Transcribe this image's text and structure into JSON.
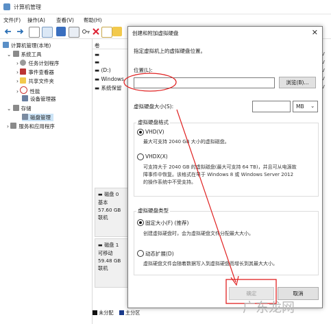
{
  "window": {
    "title": "计算机管理"
  },
  "menu": [
    "文件(F)",
    "操作(A)",
    "查看(V)",
    "帮助(H)"
  ],
  "tree": {
    "root": "计算机管理(本地)",
    "system_tools": "系统工具",
    "task_scheduler": "任务计划程序",
    "event_viewer": "事件查看器",
    "shared_folders": "共享文件夹",
    "performance": "性能",
    "device_manager": "设备管理器",
    "storage": "存储",
    "disk_management": "磁盘管理",
    "services": "服务和应用程序"
  },
  "volume_list": {
    "header": "卷",
    "rows": [
      "",
      "",
      "(D:)",
      "Windows",
      "系统保留"
    ]
  },
  "disks": [
    {
      "name": "磁盘 0",
      "type": "基本",
      "size": "57.60 GB",
      "status": "联机"
    },
    {
      "name": "磁盘 1",
      "type": "可移动",
      "size": "59.48 GB",
      "status": "联机"
    }
  ],
  "legend": {
    "unallocated": "未分配",
    "primary": "主分区"
  },
  "right_col": [
    "V",
    "V",
    "V",
    "V",
    "V"
  ],
  "dialog": {
    "title": "创建和附加虚拟硬盘",
    "instruction": "指定虚拟机上的虚拟硬盘位置。",
    "location_label": "位置(L):",
    "location_value": "",
    "browse": "浏览(B)...",
    "size_label": "虚拟硬盘大小(S):",
    "size_value": "",
    "size_unit": "MB",
    "format_group": "虚拟硬盘格式",
    "vhd_label": "VHD(V)",
    "vhd_desc": "最大可支持 2040 GB 大小的虚拟磁盘。",
    "vhdx_label": "VHDX(X)",
    "vhdx_desc_1": "可支持大于 2040 GB 的虚拟磁盘(最大可支持 64 TB)，并且可从电源故",
    "vhdx_desc_2": "障事件中恢复。该格式在早于 Windows 8 或 Windows Server 2012",
    "vhdx_desc_3": "的操作系统中不受支持。",
    "type_group": "虚拟硬盘类型",
    "fixed_label": "固定大小(F) (推荐)",
    "fixed_desc": "创建虚拟硬盘时，会为虚拟硬盘文件分配最大大小。",
    "dynamic_label": "动态扩展(D)",
    "dynamic_desc": "虚拟硬盘文件会随着数据写入到虚拟硬盘而增长到其最大大小。",
    "ok": "确定",
    "cancel": "取消"
  },
  "watermark": "广东龙网"
}
